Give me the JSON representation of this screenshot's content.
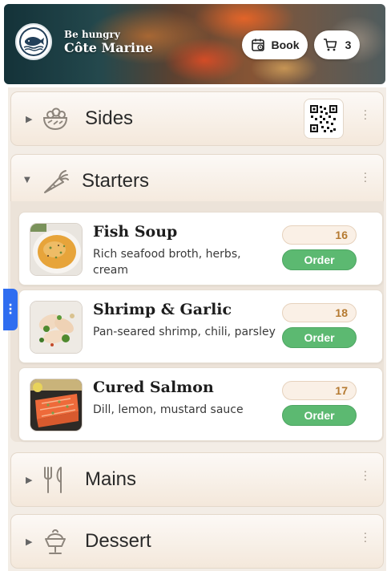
{
  "header": {
    "tagline": "Be hungry",
    "restaurant_name": "Côte Marine",
    "book_label": "Book",
    "cart_count": "3"
  },
  "sections": [
    {
      "title": "Sides",
      "expanded": false,
      "icon": "salad-bowl-icon"
    },
    {
      "title": "Starters",
      "expanded": true,
      "icon": "carrot-icon"
    },
    {
      "title": "Mains",
      "expanded": false,
      "icon": "fork-knife-icon"
    },
    {
      "title": "Dessert",
      "expanded": false,
      "icon": "ice-cream-icon"
    }
  ],
  "starters": [
    {
      "name": "Fish Soup",
      "description": "Rich seafood broth, herbs, cream",
      "price": "16",
      "order_label": "Order"
    },
    {
      "name": "Shrimp & Garlic",
      "description": "Pan-seared shrimp, chili, parsley",
      "price": "18",
      "order_label": "Order"
    },
    {
      "name": "Cured Salmon",
      "description": "Dill, lemon, mustard sauce",
      "price": "17",
      "order_label": "Order"
    }
  ],
  "colors": {
    "accent_green": "#5cb971",
    "price_text": "#b57a31",
    "side_tab": "#2f6df0"
  }
}
